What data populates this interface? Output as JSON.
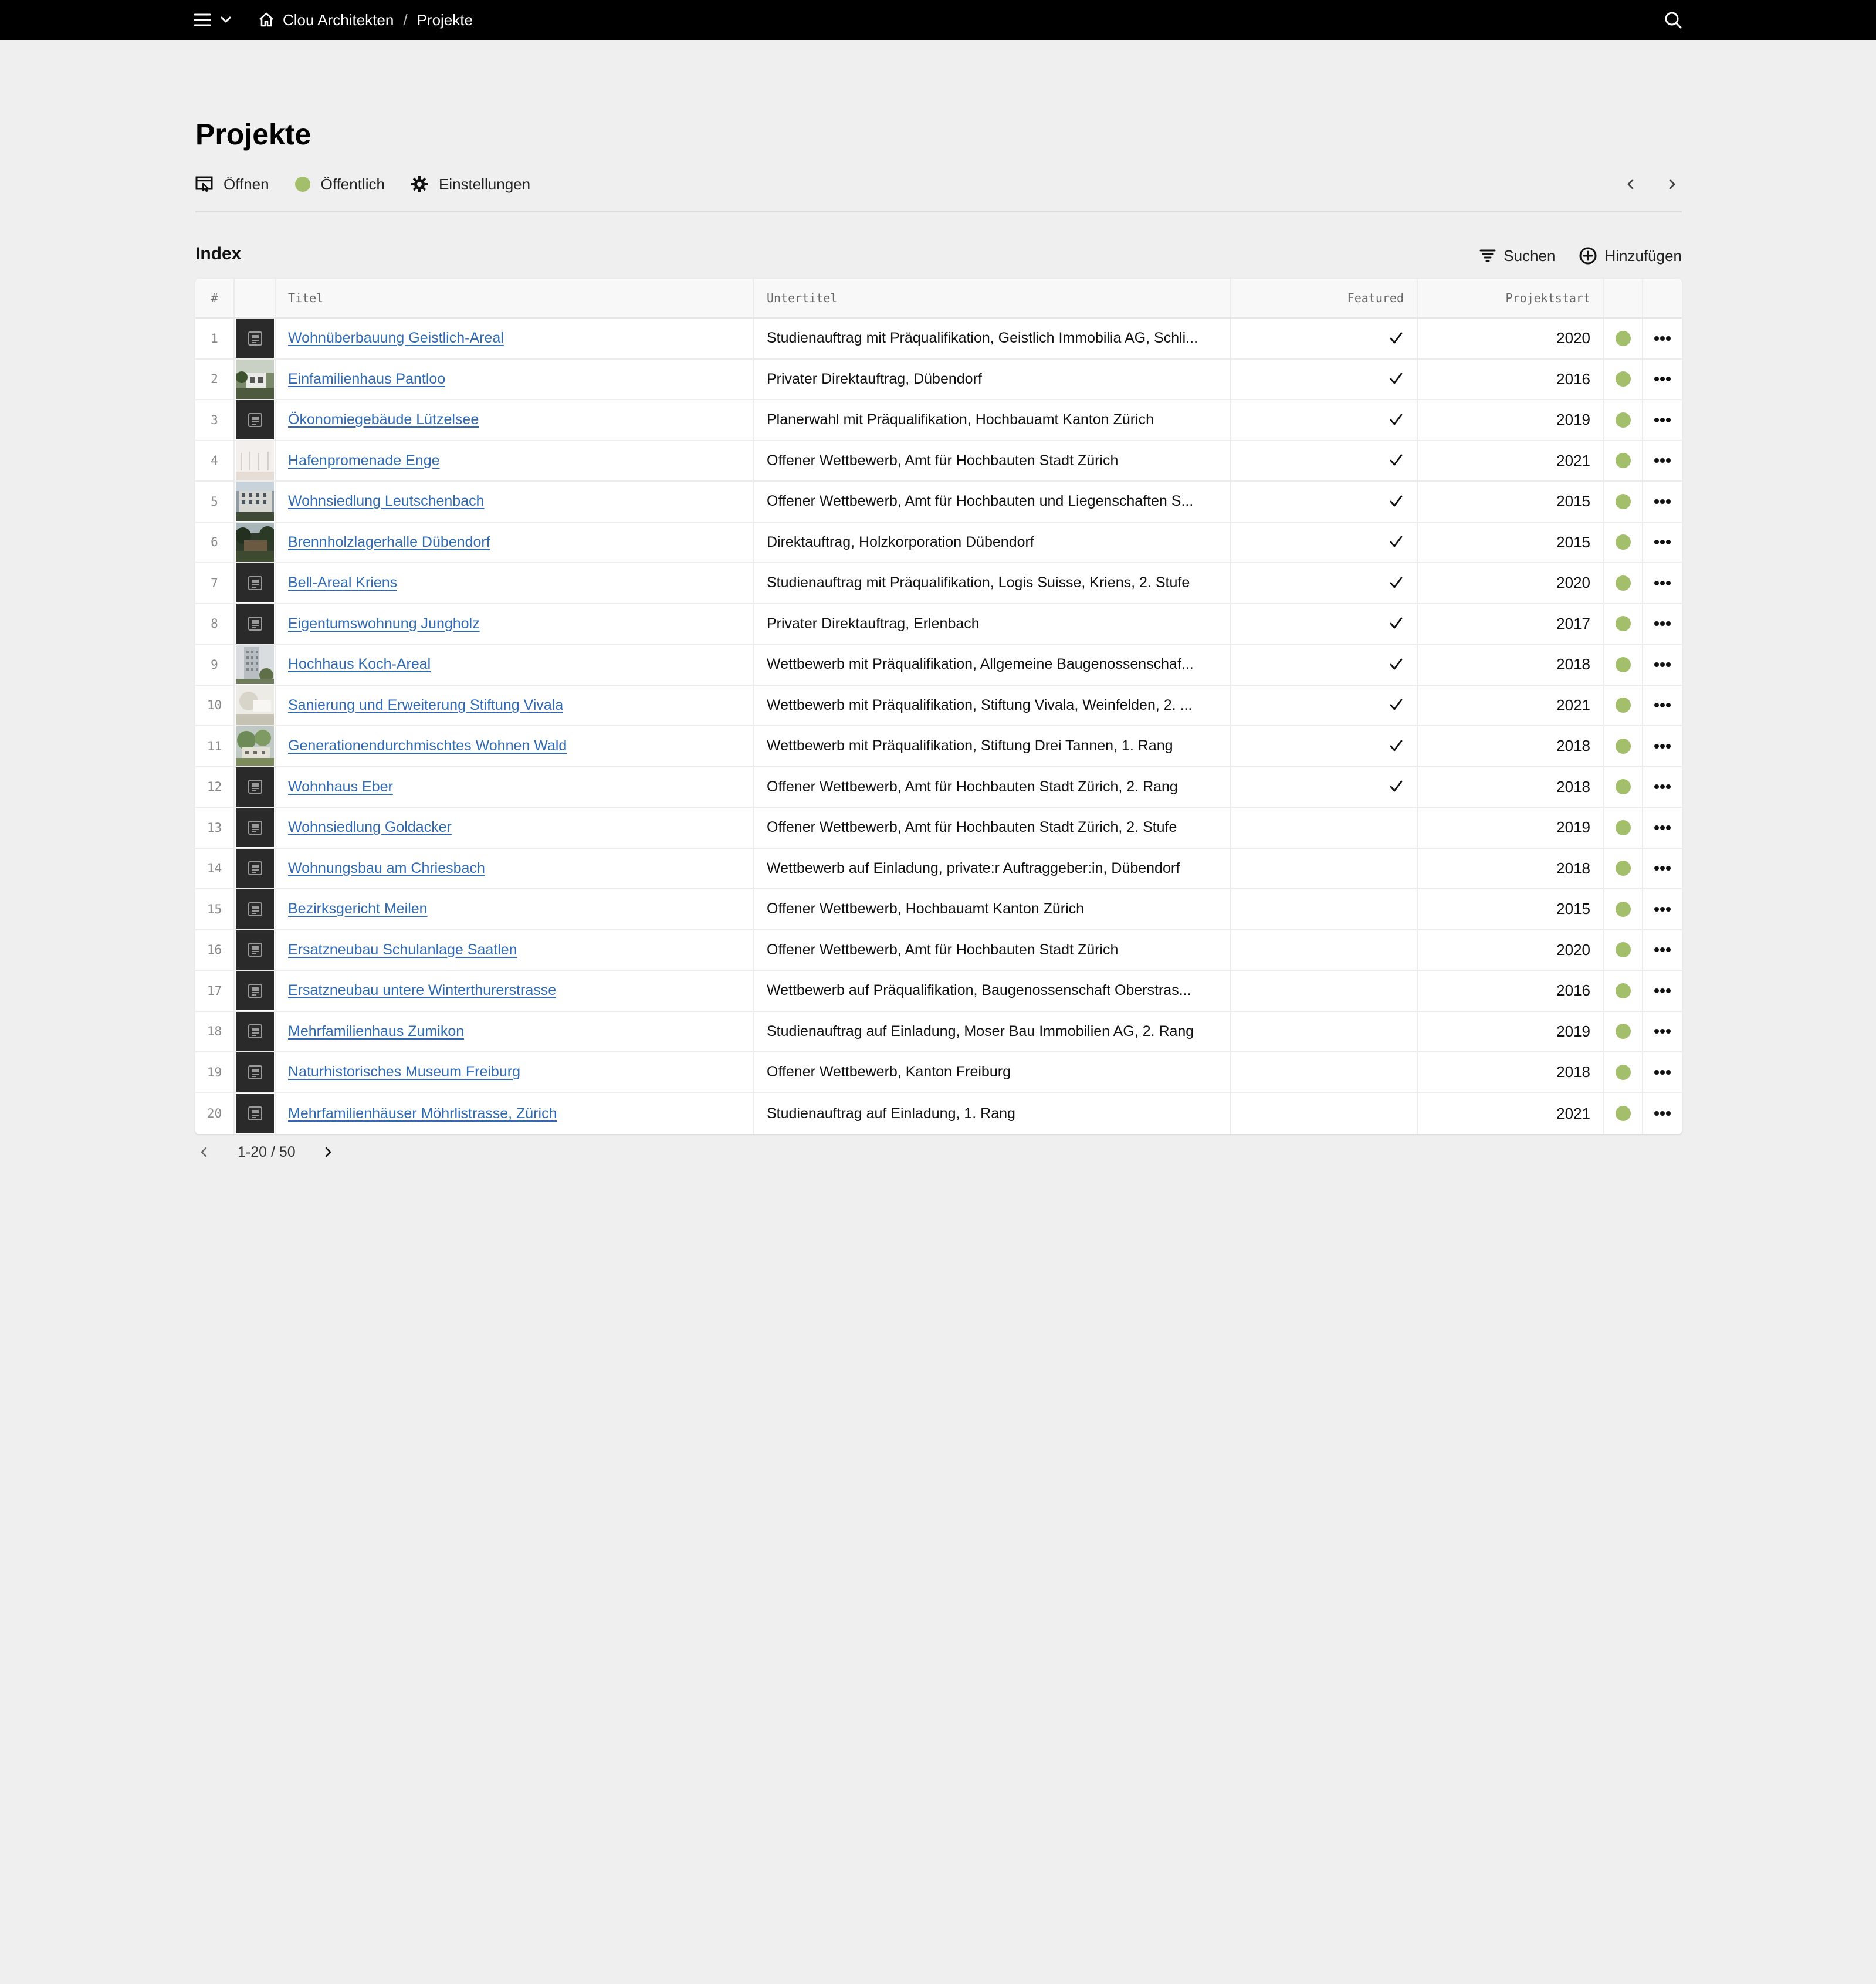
{
  "breadcrumb": {
    "site": "Clou Architekten",
    "separator": "/",
    "current": "Projekte"
  },
  "page": {
    "title": "Projekte"
  },
  "header_actions": {
    "open": "Öffnen",
    "status": "Öffentlich",
    "settings": "Einstellungen"
  },
  "section": {
    "label": "Index",
    "search": "Suchen",
    "add": "Hinzufügen"
  },
  "colors": {
    "status_public": "#a4bf6b",
    "link": "#2f6ab3",
    "topbar": "#000000"
  },
  "table": {
    "columns": {
      "num": "#",
      "title": "Titel",
      "subtitle": "Untertitel",
      "featured": "Featured",
      "start": "Projektstart"
    },
    "rows": [
      {
        "n": "1",
        "title": "Wohnüberbauung Geistlich-Areal",
        "subtitle": "Studienauftrag mit Präqualifikation, Geistlich Immobilia AG, Schli...",
        "featured": true,
        "year": "2020",
        "thumb": "placeholder"
      },
      {
        "n": "2",
        "title": "Einfamilienhaus Pantloo",
        "subtitle": "Privater Direktauftrag, Dübendorf",
        "featured": true,
        "year": "2016",
        "thumb": "house"
      },
      {
        "n": "3",
        "title": "Ökonomiegebäude Lützelsee",
        "subtitle": "Planerwahl mit Präqualifikation, Hochbauamt Kanton Zürich",
        "featured": true,
        "year": "2019",
        "thumb": "placeholder"
      },
      {
        "n": "4",
        "title": "Hafenpromenade Enge",
        "subtitle": "Offener Wettbewerb, Amt für Hochbauten Stadt Zürich",
        "featured": true,
        "year": "2021",
        "thumb": "light"
      },
      {
        "n": "5",
        "title": "Wohnsiedlung Leutschenbach",
        "subtitle": "Offener Wettbewerb, Amt für Hochbauten und Liegenschaften S...",
        "featured": true,
        "year": "2015",
        "thumb": "building"
      },
      {
        "n": "6",
        "title": "Brennholzlagerhalle Dübendorf",
        "subtitle": "Direktauftrag, Holzkorporation Dübendorf",
        "featured": true,
        "year": "2015",
        "thumb": "forest"
      },
      {
        "n": "7",
        "title": "Bell-Areal Kriens",
        "subtitle": "Studienauftrag mit Präqualifikation, Logis Suisse, Kriens, 2. Stufe",
        "featured": true,
        "year": "2020",
        "thumb": "placeholder"
      },
      {
        "n": "8",
        "title": "Eigentumswohnung Jungholz",
        "subtitle": "Privater Direktauftrag, Erlenbach",
        "featured": true,
        "year": "2017",
        "thumb": "placeholder"
      },
      {
        "n": "9",
        "title": "Hochhaus Koch-Areal",
        "subtitle": "Wettbewerb mit Präqualifikation, Allgemeine Baugenossenschaf...",
        "featured": true,
        "year": "2018",
        "thumb": "tower"
      },
      {
        "n": "10",
        "title": "Sanierung und Erweiterung Stiftung Vivala",
        "subtitle": "Wettbewerb mit Präqualifikation, Stiftung Vivala, Weinfelden, 2. ...",
        "featured": true,
        "year": "2021",
        "thumb": "light2"
      },
      {
        "n": "11",
        "title": "Generationendurchmischtes Wohnen Wald",
        "subtitle": "Wettbewerb mit Präqualifikation, Stiftung Drei Tannen, 1. Rang",
        "featured": true,
        "year": "2018",
        "thumb": "trees"
      },
      {
        "n": "12",
        "title": "Wohnhaus Eber",
        "subtitle": "Offener Wettbewerb, Amt für Hochbauten Stadt Zürich, 2. Rang",
        "featured": true,
        "year": "2018",
        "thumb": "placeholder"
      },
      {
        "n": "13",
        "title": "Wohnsiedlung Goldacker",
        "subtitle": "Offener Wettbewerb, Amt für Hochbauten Stadt Zürich, 2. Stufe",
        "featured": false,
        "year": "2019",
        "thumb": "placeholder"
      },
      {
        "n": "14",
        "title": "Wohnungsbau am Chriesbach",
        "subtitle": "Wettbewerb auf Einladung, private:r Auftraggeber:in, Dübendorf",
        "featured": false,
        "year": "2018",
        "thumb": "placeholder"
      },
      {
        "n": "15",
        "title": "Bezirksgericht Meilen",
        "subtitle": "Offener Wettbewerb, Hochbauamt Kanton Zürich",
        "featured": false,
        "year": "2015",
        "thumb": "placeholder"
      },
      {
        "n": "16",
        "title": "Ersatzneubau Schulanlage Saatlen",
        "subtitle": "Offener Wettbewerb, Amt für Hochbauten Stadt Zürich",
        "featured": false,
        "year": "2020",
        "thumb": "placeholder"
      },
      {
        "n": "17",
        "title": "Ersatzneubau untere Winterthurerstrasse",
        "subtitle": "Wettbewerb auf Präqualifikation, Baugenossenschaft Oberstras...",
        "featured": false,
        "year": "2016",
        "thumb": "placeholder"
      },
      {
        "n": "18",
        "title": "Mehrfamilienhaus Zumikon",
        "subtitle": "Studienauftrag auf Einladung, Moser Bau Immobilien AG, 2. Rang",
        "featured": false,
        "year": "2019",
        "thumb": "placeholder"
      },
      {
        "n": "19",
        "title": "Naturhistorisches Museum Freiburg",
        "subtitle": "Offener Wettbewerb, Kanton Freiburg",
        "featured": false,
        "year": "2018",
        "thumb": "placeholder"
      },
      {
        "n": "20",
        "title": "Mehrfamilienhäuser Möhrlistrasse, Zürich",
        "subtitle": "Studienauftrag auf Einladung, 1. Rang",
        "featured": false,
        "year": "2021",
        "thumb": "placeholder"
      }
    ]
  },
  "pagination": {
    "label": "1-20 / 50"
  }
}
